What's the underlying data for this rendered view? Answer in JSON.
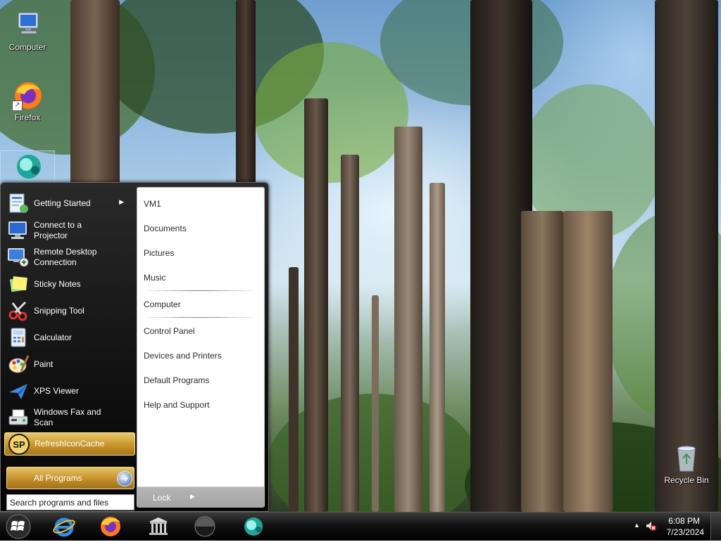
{
  "desktop": {
    "icons": [
      {
        "label": "Computer",
        "icon": "computer-icon"
      },
      {
        "label": "Firefox",
        "icon": "firefox-icon"
      },
      {
        "label": "",
        "icon": "app-icon"
      },
      {
        "label": "Recycle Bin",
        "icon": "recycle-bin-icon"
      }
    ]
  },
  "start_menu": {
    "programs": [
      {
        "label": "Getting Started",
        "icon": "getting-started-icon",
        "has_submenu": true
      },
      {
        "label": "Connect to a Projector",
        "icon": "projector-icon"
      },
      {
        "label": "Remote Desktop Connection",
        "icon": "remote-desktop-icon"
      },
      {
        "label": "Sticky Notes",
        "icon": "sticky-notes-icon"
      },
      {
        "label": "Snipping Tool",
        "icon": "scissors-icon"
      },
      {
        "label": "Calculator",
        "icon": "calculator-icon"
      },
      {
        "label": "Paint",
        "icon": "paint-palette-icon"
      },
      {
        "label": "XPS Viewer",
        "icon": "xps-viewer-icon"
      },
      {
        "label": "Windows Fax and Scan",
        "icon": "fax-icon"
      },
      {
        "label": "RefreshIconCache",
        "icon": "sp-icon",
        "highlighted": true
      }
    ],
    "all_programs_label": "All Programs",
    "search_placeholder": "Search programs and files",
    "places": [
      "VM1",
      "Documents",
      "Pictures",
      "Music",
      "Computer",
      "Control Panel",
      "Devices and Printers",
      "Default Programs",
      "Help and Support"
    ],
    "lock_label": "Lock"
  },
  "taskbar": {
    "pinned": [
      "internet-explorer-icon",
      "firefox-icon",
      "library-icon",
      "media-orb-icon",
      "app-icon"
    ],
    "time": "6:08 PM",
    "date": "7/23/2024"
  },
  "colors": {
    "start_menu_bg": "#111111",
    "highlight_gold": "#c8952a",
    "taskbar_bg": "#121212"
  }
}
